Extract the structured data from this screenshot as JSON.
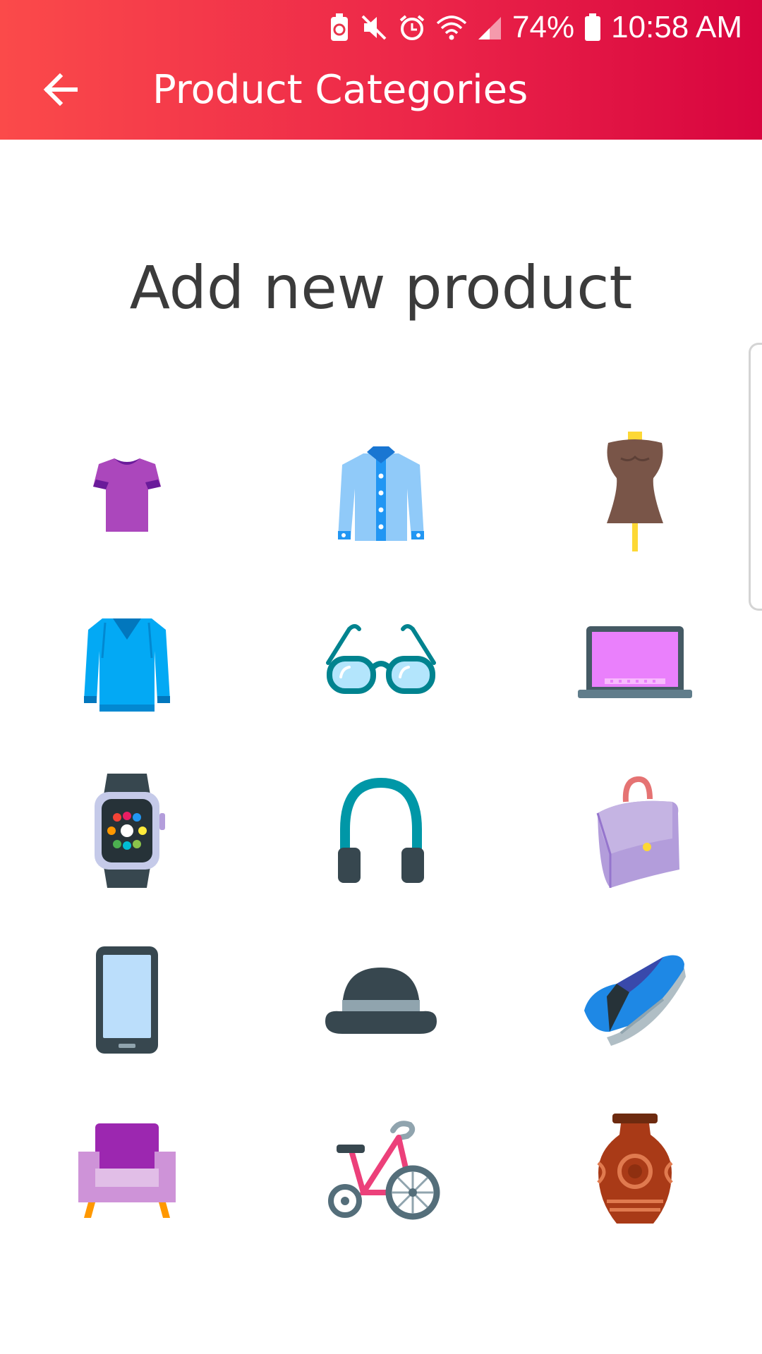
{
  "status_bar": {
    "battery_percent": "74%",
    "time": "10:58 AM"
  },
  "toolbar": {
    "title": "Product Categories",
    "back_icon": "arrow-left-icon"
  },
  "main": {
    "heading": "Add new product",
    "categories": [
      {
        "icon": "tshirt-icon"
      },
      {
        "icon": "shirt-icon"
      },
      {
        "icon": "mannequin-icon"
      },
      {
        "icon": "sweater-icon"
      },
      {
        "icon": "glasses-icon"
      },
      {
        "icon": "laptop-icon"
      },
      {
        "icon": "smartwatch-icon"
      },
      {
        "icon": "headphones-icon"
      },
      {
        "icon": "handbag-icon"
      },
      {
        "icon": "smartphone-icon"
      },
      {
        "icon": "bowler-hat-icon"
      },
      {
        "icon": "sneaker-icon"
      },
      {
        "icon": "armchair-icon"
      },
      {
        "icon": "tricycle-icon"
      },
      {
        "icon": "vase-icon"
      }
    ]
  },
  "colors": {
    "app_bar_start": "#fb4a4a",
    "app_bar_end": "#d8053f",
    "heading_text": "#3b3b3b"
  }
}
